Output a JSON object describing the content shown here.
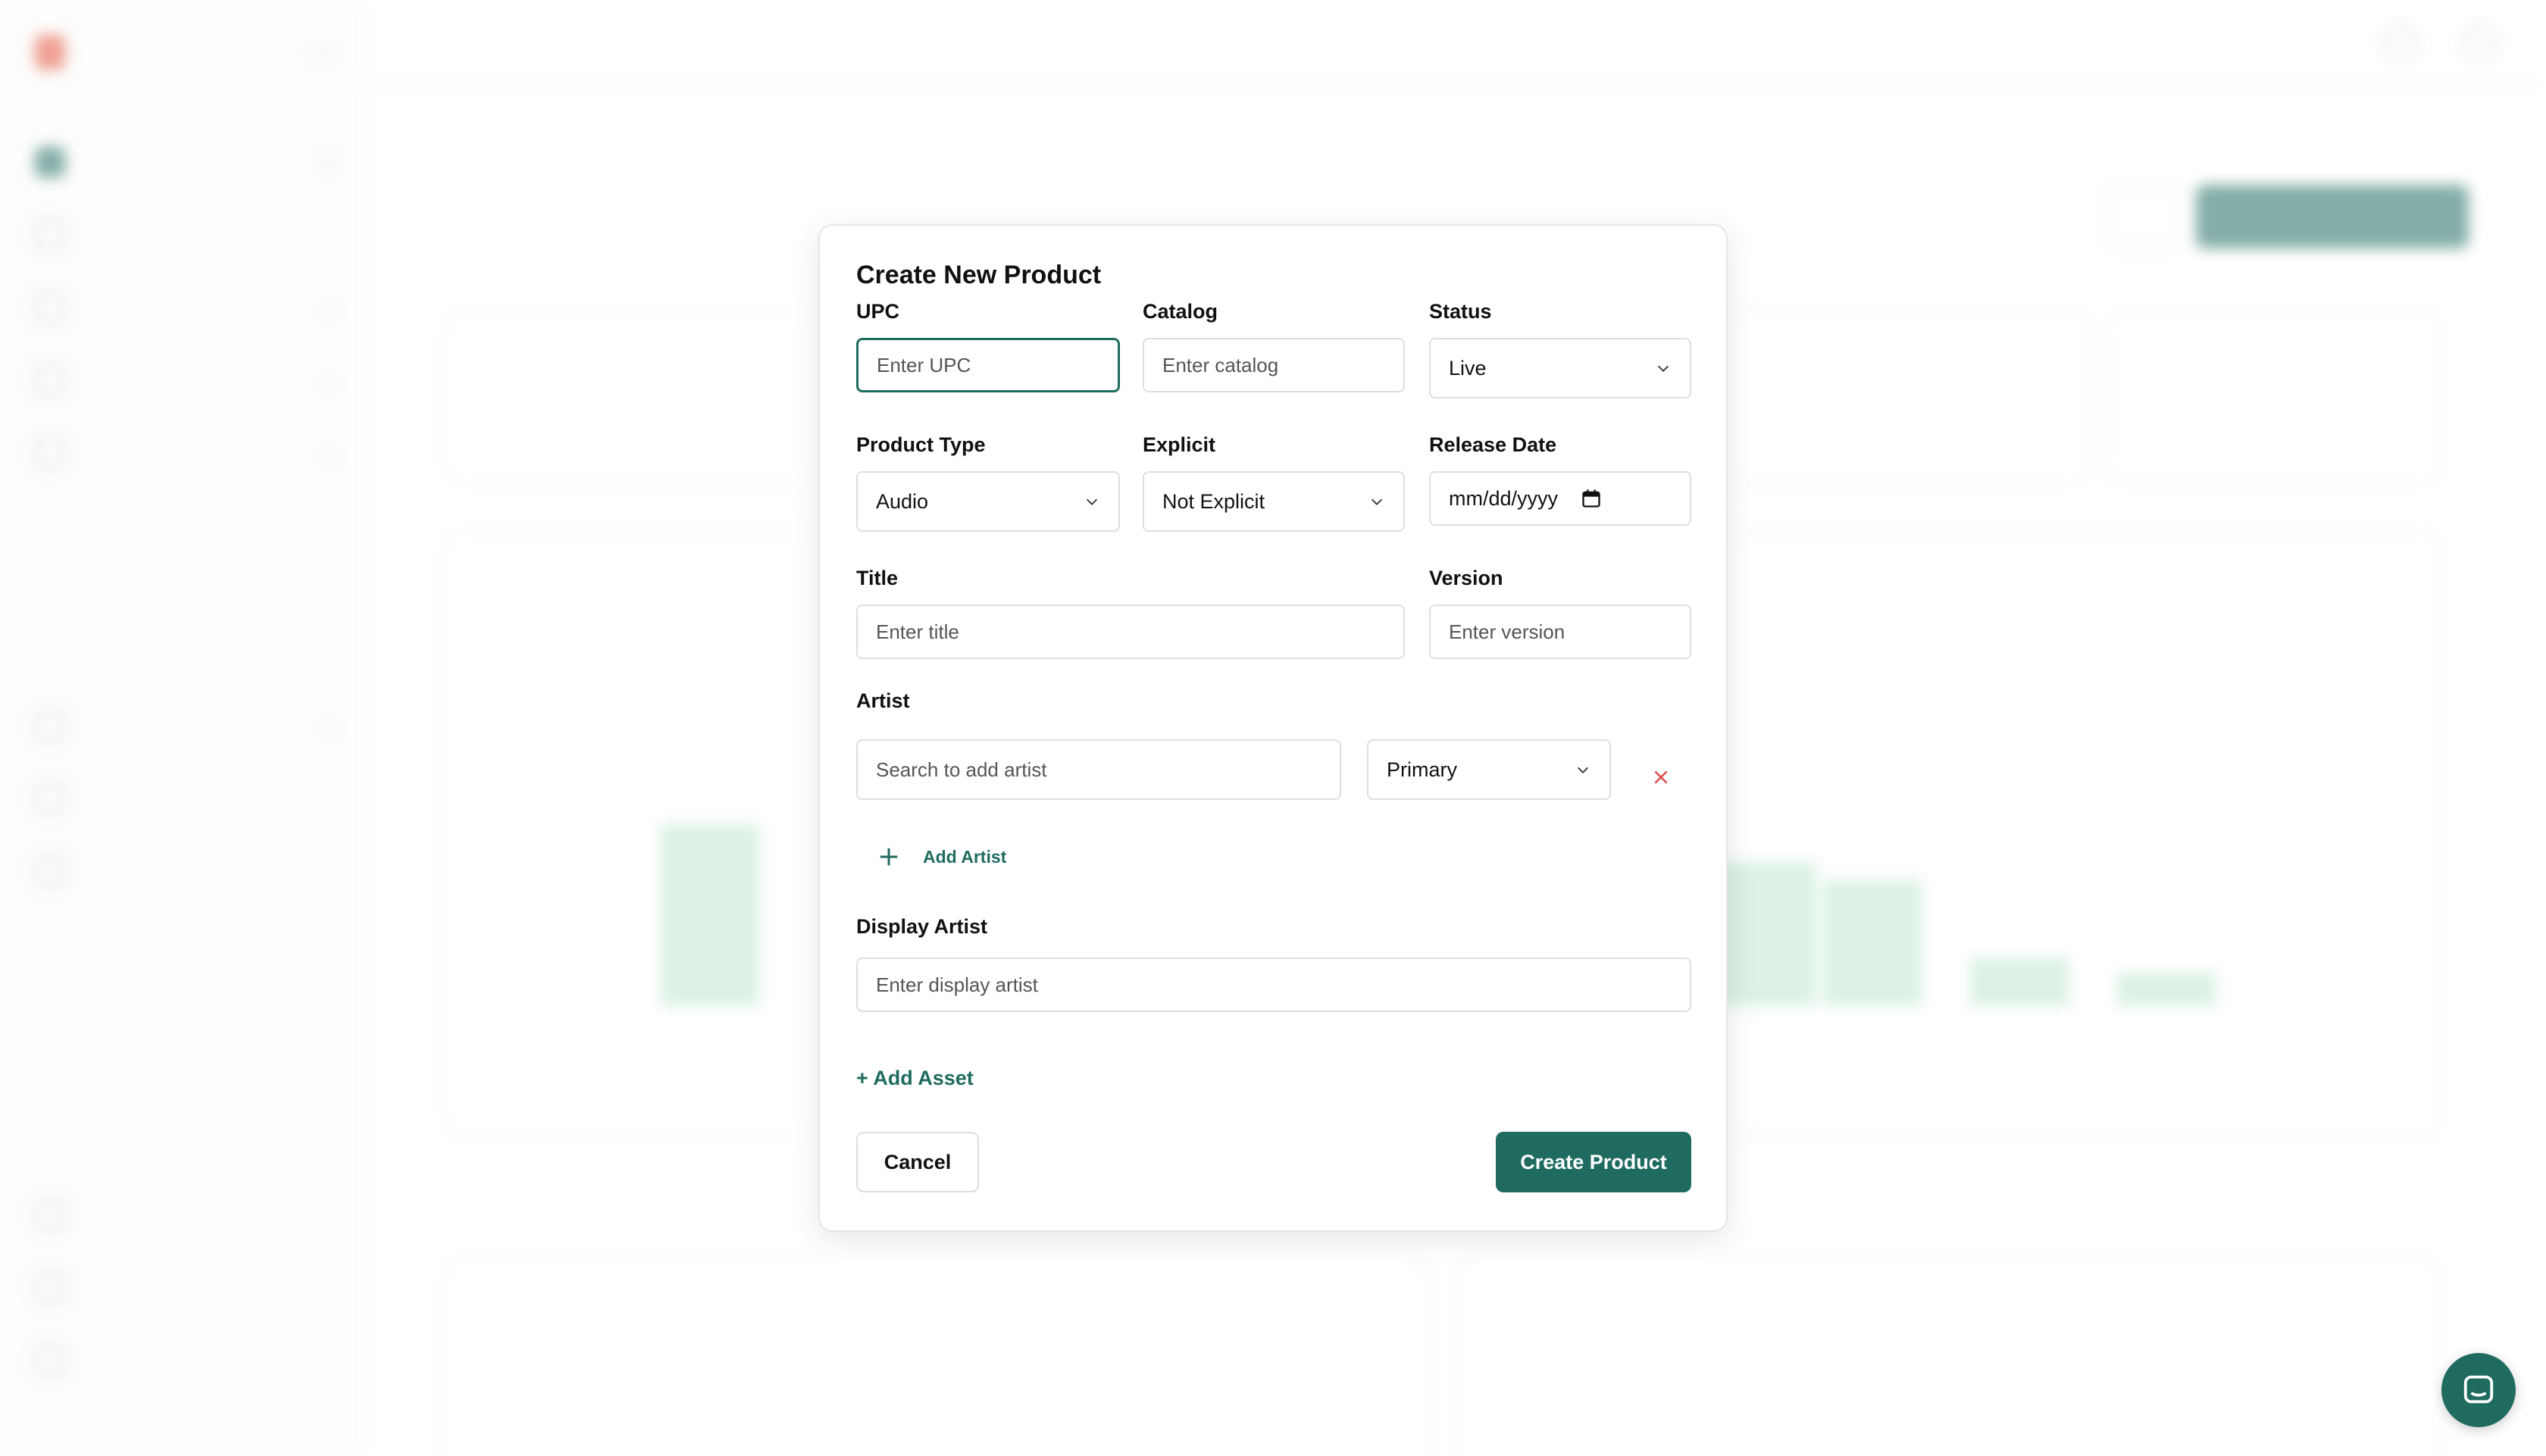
{
  "modal": {
    "title": "Create New Product",
    "upc": {
      "label": "UPC",
      "placeholder": "Enter UPC"
    },
    "catalog": {
      "label": "Catalog",
      "placeholder": "Enter catalog"
    },
    "status": {
      "label": "Status",
      "value": "Live"
    },
    "product_type": {
      "label": "Product Type",
      "value": "Audio"
    },
    "explicit": {
      "label": "Explicit",
      "value": "Not Explicit"
    },
    "release_date": {
      "label": "Release Date",
      "value": "mm/dd/yyyy"
    },
    "title_field": {
      "label": "Title",
      "placeholder": "Enter title"
    },
    "version": {
      "label": "Version",
      "placeholder": "Enter version"
    },
    "artist": {
      "label": "Artist",
      "search_placeholder": "Search to add artist",
      "role": "Primary",
      "add_label": "Add Artist"
    },
    "display_artist": {
      "label": "Display Artist",
      "placeholder": "Enter display artist"
    },
    "add_asset_label": "+ Add Asset",
    "cancel_label": "Cancel",
    "create_label": "Create Product"
  },
  "colors": {
    "accent": "#1f6b5f",
    "remove": "#d9534f"
  },
  "icons": {
    "chevron": "chevron-down-icon",
    "calendar": "calendar-icon",
    "remove": "close-icon",
    "add": "plus-icon",
    "chat": "chat-icon"
  }
}
